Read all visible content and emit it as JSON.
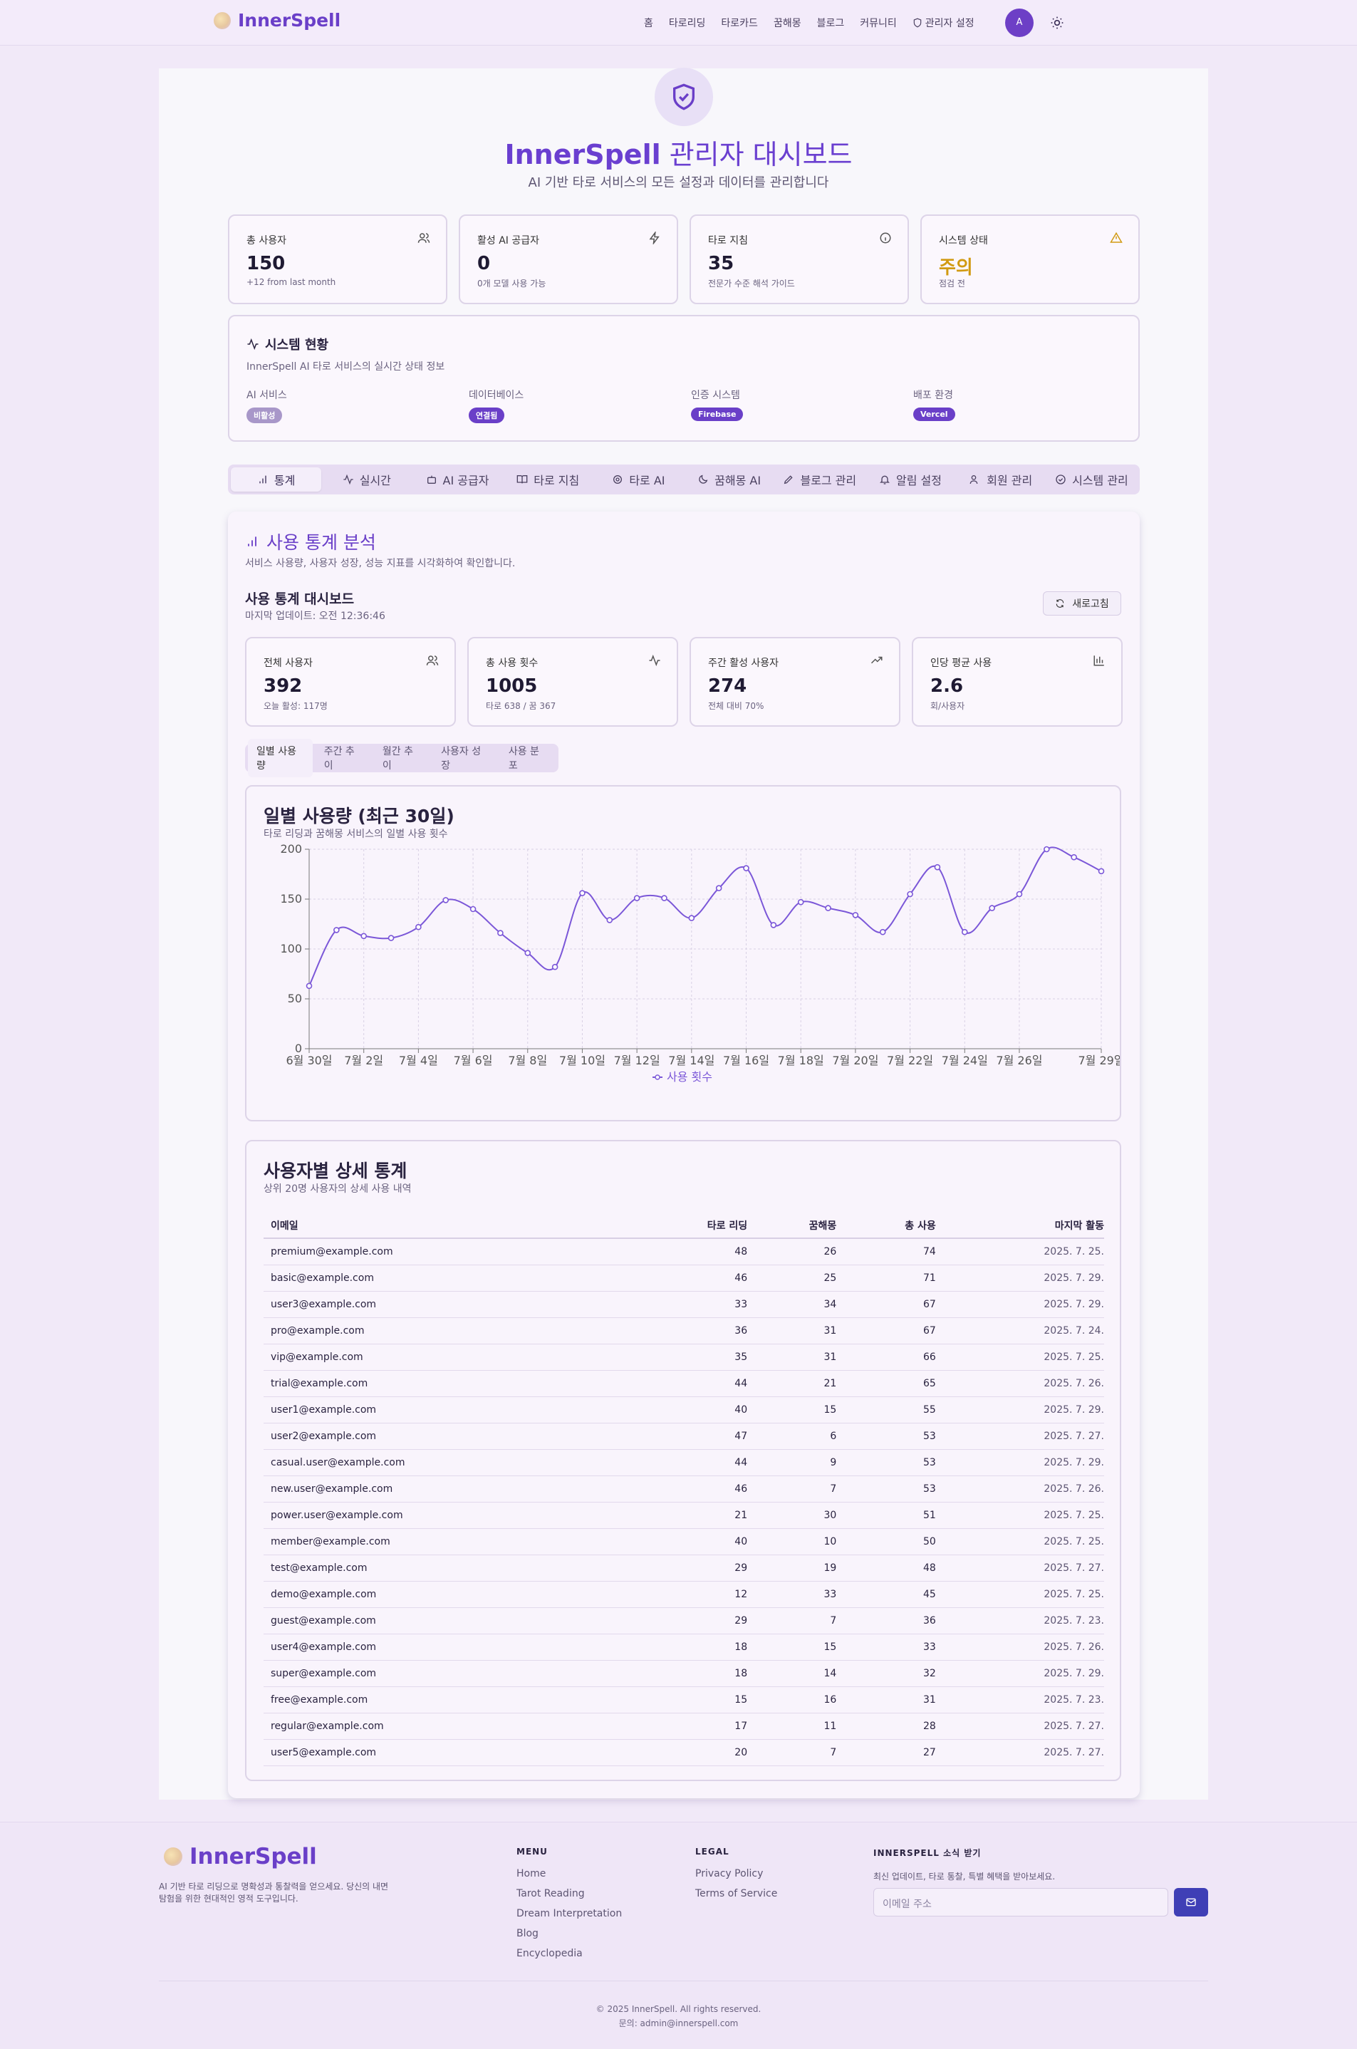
{
  "header": {
    "brand": "InnerSpell",
    "nav": [
      "홈",
      "타로리딩",
      "타로카드",
      "꿈해몽",
      "블로그",
      "커뮤니티"
    ],
    "admin_label": "관리자 설정",
    "avatar_letter": "A"
  },
  "hero": {
    "title_brand": "InnerSpell",
    "title_rest": " 관리자 대시보드",
    "subtitle": "AI 기반 타로 서비스의 모든 설정과 데이터를 관리합니다"
  },
  "stats": [
    {
      "label": "총 사용자",
      "value": "150",
      "sub": "+12 from last month",
      "icon": "users-icon"
    },
    {
      "label": "활성 AI 공급자",
      "value": "0",
      "sub": "0개 모델 사용 가능",
      "icon": "zap-icon"
    },
    {
      "label": "타로 지침",
      "value": "35",
      "sub": "전문가 수준 해석 가이드",
      "icon": "info-icon"
    },
    {
      "label": "시스템 상태",
      "value": "주의",
      "sub": "점검 전",
      "icon": "warning-icon"
    }
  ],
  "system_status": {
    "title": "시스템 현황",
    "desc": "InnerSpell AI 타로 서비스의 실시간 상태 정보",
    "items": [
      {
        "label": "AI 서비스",
        "badge": "비활성"
      },
      {
        "label": "데이터베이스",
        "badge": "연결됨"
      },
      {
        "label": "인증 시스템",
        "badge": "Firebase"
      },
      {
        "label": "배포 환경",
        "badge": "Vercel"
      }
    ]
  },
  "tabs": [
    "통계",
    "실시간",
    "AI 공급자",
    "타로 지침",
    "타로 AI",
    "꿈해몽 AI",
    "블로그 관리",
    "알림 설정",
    "회원 관리",
    "시스템 관리"
  ],
  "usage": {
    "title": "사용 통계 분석",
    "desc": "서비스 사용량, 사용자 성장, 성능 지표를 시각화하여 확인합니다.",
    "dash_title": "사용 통계 대시보드",
    "updated": "마지막 업데이트: 오전 12:36:46",
    "refresh": "새로고침",
    "cards": [
      {
        "label": "전체 사용자",
        "value": "392",
        "sub": "오늘 활성: 117명"
      },
      {
        "label": "총 사용 횟수",
        "value": "1005",
        "sub": "타로 638 / 꿈 367"
      },
      {
        "label": "주간 활성 사용자",
        "value": "274",
        "sub": "전체 대비 70%"
      },
      {
        "label": "인당 평균 사용",
        "value": "2.6",
        "sub": "회/사용자"
      }
    ],
    "subtabs": [
      "일별 사용량",
      "주간 추이",
      "월간 추이",
      "사용자 성장",
      "사용 분포"
    ]
  },
  "chart_title": "일별 사용량 (최근 30일)",
  "chart_subtitle": "타로 리딩과 꿈해몽 서비스의 일별 사용 횟수",
  "chart_data": {
    "type": "line",
    "x_tick_labels": [
      "6월 30일",
      "7월 2일",
      "7월 4일",
      "7월 6일",
      "7월 8일",
      "7월 10일",
      "7월 12일",
      "7월 14일",
      "7월 16일",
      "7월 18일",
      "7월 20일",
      "7월 22일",
      "7월 24일",
      "7월 26일",
      "7월 29일"
    ],
    "series": [
      {
        "name": "사용 횟수",
        "values": [
          63,
          119,
          113,
          111,
          122,
          149,
          140,
          116,
          96,
          82,
          156,
          129,
          151,
          151,
          131,
          161,
          181,
          124,
          147,
          141,
          134,
          117,
          155,
          182,
          117,
          141,
          155,
          200,
          192,
          178
        ]
      }
    ],
    "ylim": [
      0,
      200
    ],
    "y_ticks": [
      0,
      50,
      100,
      150,
      200
    ],
    "color": "#7b57d8",
    "grid": true,
    "legend": "bottom"
  },
  "table": {
    "title": "사용자별 상세 통계",
    "subtitle": "상위 20명 사용자의 상세 사용 내역",
    "headers": [
      "이메일",
      "타로 리딩",
      "꿈해몽",
      "총 사용",
      "마지막 활동"
    ],
    "rows": [
      [
        "premium@example.com",
        "48",
        "26",
        "74",
        "2025. 7. 25."
      ],
      [
        "basic@example.com",
        "46",
        "25",
        "71",
        "2025. 7. 29."
      ],
      [
        "user3@example.com",
        "33",
        "34",
        "67",
        "2025. 7. 29."
      ],
      [
        "pro@example.com",
        "36",
        "31",
        "67",
        "2025. 7. 24."
      ],
      [
        "vip@example.com",
        "35",
        "31",
        "66",
        "2025. 7. 25."
      ],
      [
        "trial@example.com",
        "44",
        "21",
        "65",
        "2025. 7. 26."
      ],
      [
        "user1@example.com",
        "40",
        "15",
        "55",
        "2025. 7. 29."
      ],
      [
        "user2@example.com",
        "47",
        "6",
        "53",
        "2025. 7. 27."
      ],
      [
        "casual.user@example.com",
        "44",
        "9",
        "53",
        "2025. 7. 29."
      ],
      [
        "new.user@example.com",
        "46",
        "7",
        "53",
        "2025. 7. 26."
      ],
      [
        "power.user@example.com",
        "21",
        "30",
        "51",
        "2025. 7. 25."
      ],
      [
        "member@example.com",
        "40",
        "10",
        "50",
        "2025. 7. 25."
      ],
      [
        "test@example.com",
        "29",
        "19",
        "48",
        "2025. 7. 27."
      ],
      [
        "demo@example.com",
        "12",
        "33",
        "45",
        "2025. 7. 25."
      ],
      [
        "guest@example.com",
        "29",
        "7",
        "36",
        "2025. 7. 23."
      ],
      [
        "user4@example.com",
        "18",
        "15",
        "33",
        "2025. 7. 26."
      ],
      [
        "super@example.com",
        "18",
        "14",
        "32",
        "2025. 7. 29."
      ],
      [
        "free@example.com",
        "15",
        "16",
        "31",
        "2025. 7. 23."
      ],
      [
        "regular@example.com",
        "17",
        "11",
        "28",
        "2025. 7. 27."
      ],
      [
        "user5@example.com",
        "20",
        "7",
        "27",
        "2025. 7. 27."
      ]
    ]
  },
  "footer": {
    "brand": "InnerSpell",
    "desc": "AI 기반 타로 리딩으로 명확성과 통찰력을 얻으세요. 당신의 내면 탐험을 위한 현대적인 영적 도구입니다.",
    "menu_title": "MENU",
    "menu": [
      "Home",
      "Tarot Reading",
      "Dream Interpretation",
      "Blog",
      "Encyclopedia"
    ],
    "legal_title": "LEGAL",
    "legal": [
      "Privacy Policy",
      "Terms of Service"
    ],
    "news_title": "INNERSPELL 소식 받기",
    "news_desc": "최신 업데이트, 타로 통찰, 특별 혜택을 받아보세요.",
    "email_placeholder": "이메일 주소",
    "copyright": "© 2025 InnerSpell. All rights reserved.",
    "contact": "문의: admin@innerspell.com"
  }
}
